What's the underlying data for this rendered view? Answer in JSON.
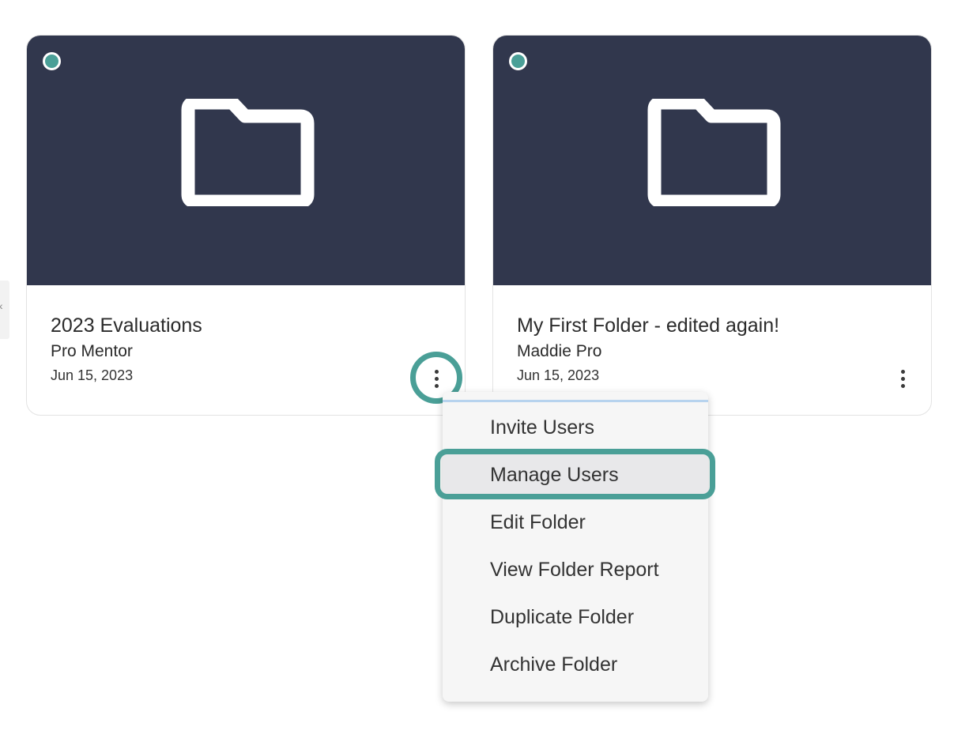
{
  "folders": [
    {
      "title": "2023 Evaluations",
      "owner": "Pro Mentor",
      "date": "Jun 15, 2023",
      "status_color": "#4a9f97",
      "icon": "folder-icon",
      "more_icon": "more-vertical-icon"
    },
    {
      "title": "My First Folder - edited again!",
      "owner": "Maddie Pro",
      "date": "Jun 15, 2023",
      "status_color": "#4a9f97",
      "icon": "folder-icon",
      "more_icon": "more-vertical-icon"
    }
  ],
  "context_menu": {
    "items": [
      {
        "label": "Invite Users"
      },
      {
        "label": "Manage Users"
      },
      {
        "label": "Edit Folder"
      },
      {
        "label": "View Folder Report"
      },
      {
        "label": "Duplicate Folder"
      },
      {
        "label": "Archive Folder"
      }
    ],
    "active_item": "Manage Users"
  },
  "side_tab": {
    "glyph": "‹"
  },
  "colors": {
    "banner": "#31374d",
    "accent": "#4a9f97",
    "menu_bg": "#f6f6f6",
    "menu_active": "#e8e8ea"
  }
}
